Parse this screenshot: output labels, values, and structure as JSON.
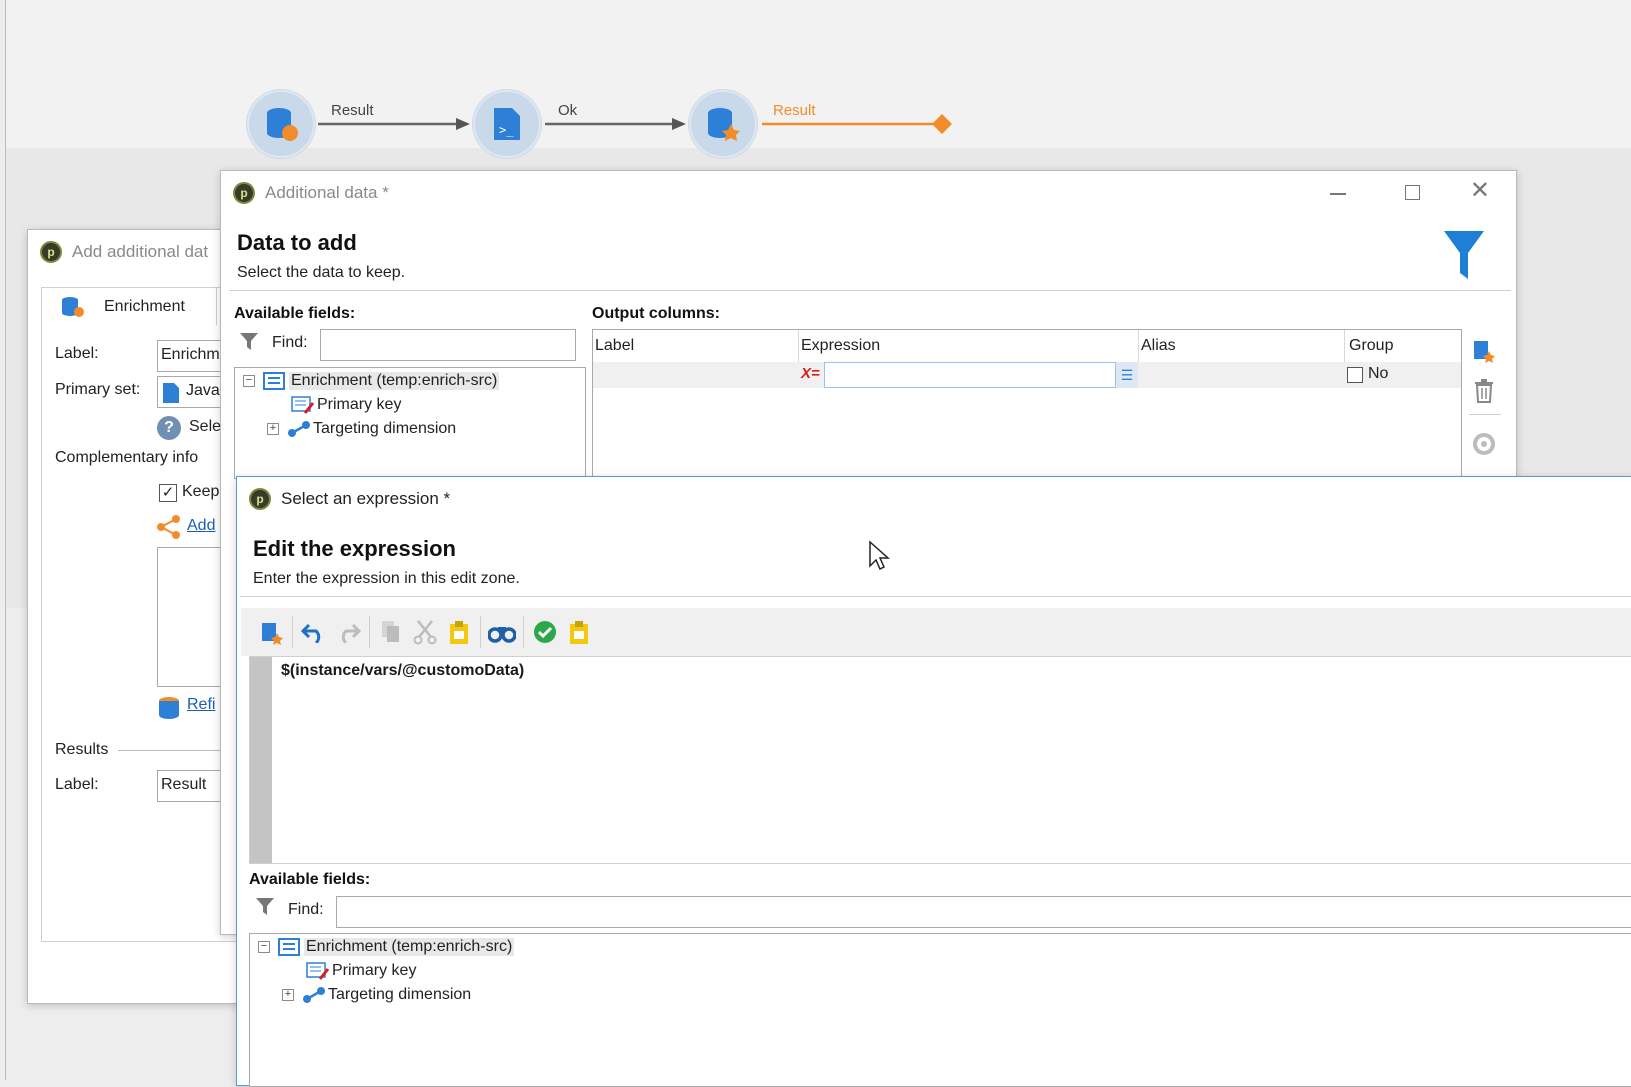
{
  "workflow": {
    "edge1_label": "Result",
    "edge2_label": "Ok",
    "edge3_label": "Result",
    "accent_color": "#f28c28"
  },
  "back_dialog": {
    "title": "Add additional dat",
    "tab_label": "Enrichment",
    "label_caption": "Label:",
    "label_value": "Enrichm",
    "primary_set_caption": "Primary set:",
    "primary_set_value": "Java:",
    "select_text": "Sele",
    "complementary_caption": "Complementary info",
    "keep_text": "Keep",
    "add_link": "Add",
    "refine_link": "Refi",
    "results_caption": "Results",
    "result_label_caption": "Label:",
    "result_label_value": "Result"
  },
  "additional_data": {
    "title": "Additional data *",
    "heading": "Data to add",
    "subheading": "Select the data to keep.",
    "available_fields_caption": "Available fields:",
    "find_caption": "Find:",
    "find_value": "",
    "tree": [
      {
        "label": "Enrichment (temp:enrich-src)"
      },
      {
        "label": "Primary key"
      },
      {
        "label": "Targeting dimension"
      }
    ],
    "output_columns_caption": "Output columns:",
    "columns": [
      "Label",
      "Expression",
      "Alias",
      "Group"
    ],
    "row": {
      "expression_prefix": "X=",
      "expression_value": "",
      "group_value": "No"
    }
  },
  "expression_dialog": {
    "title": "Select an expression *",
    "heading": "Edit the expression",
    "subheading": "Enter the expression in this edit zone.",
    "toolbar_icons": [
      "add-field-icon",
      "undo-icon",
      "redo-icon",
      "copy-icon",
      "cut-icon",
      "paste-icon",
      "find-icon",
      "check-icon",
      "paste-special-icon"
    ],
    "expression_text": "$(instance/vars/@customoData)",
    "available_fields_caption": "Available fields:",
    "find_caption": "Find:",
    "find_value": "",
    "tree": [
      {
        "label": "Enrichment (temp:enrich-src)"
      },
      {
        "label": "Primary key"
      },
      {
        "label": "Targeting dimension"
      }
    ]
  }
}
